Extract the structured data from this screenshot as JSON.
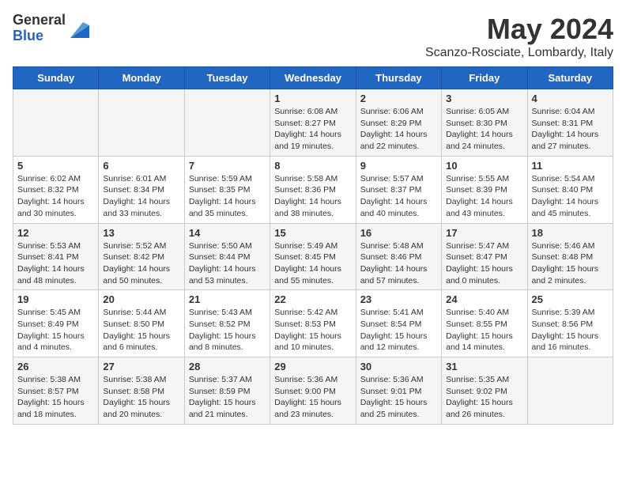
{
  "logo": {
    "general": "General",
    "blue": "Blue"
  },
  "title": "May 2024",
  "location": "Scanzo-Rosciate, Lombardy, Italy",
  "days_of_week": [
    "Sunday",
    "Monday",
    "Tuesday",
    "Wednesday",
    "Thursday",
    "Friday",
    "Saturday"
  ],
  "weeks": [
    [
      {
        "day": "",
        "info": ""
      },
      {
        "day": "",
        "info": ""
      },
      {
        "day": "",
        "info": ""
      },
      {
        "day": "1",
        "info": "Sunrise: 6:08 AM\nSunset: 8:27 PM\nDaylight: 14 hours\nand 19 minutes."
      },
      {
        "day": "2",
        "info": "Sunrise: 6:06 AM\nSunset: 8:29 PM\nDaylight: 14 hours\nand 22 minutes."
      },
      {
        "day": "3",
        "info": "Sunrise: 6:05 AM\nSunset: 8:30 PM\nDaylight: 14 hours\nand 24 minutes."
      },
      {
        "day": "4",
        "info": "Sunrise: 6:04 AM\nSunset: 8:31 PM\nDaylight: 14 hours\nand 27 minutes."
      }
    ],
    [
      {
        "day": "5",
        "info": "Sunrise: 6:02 AM\nSunset: 8:32 PM\nDaylight: 14 hours\nand 30 minutes."
      },
      {
        "day": "6",
        "info": "Sunrise: 6:01 AM\nSunset: 8:34 PM\nDaylight: 14 hours\nand 33 minutes."
      },
      {
        "day": "7",
        "info": "Sunrise: 5:59 AM\nSunset: 8:35 PM\nDaylight: 14 hours\nand 35 minutes."
      },
      {
        "day": "8",
        "info": "Sunrise: 5:58 AM\nSunset: 8:36 PM\nDaylight: 14 hours\nand 38 minutes."
      },
      {
        "day": "9",
        "info": "Sunrise: 5:57 AM\nSunset: 8:37 PM\nDaylight: 14 hours\nand 40 minutes."
      },
      {
        "day": "10",
        "info": "Sunrise: 5:55 AM\nSunset: 8:39 PM\nDaylight: 14 hours\nand 43 minutes."
      },
      {
        "day": "11",
        "info": "Sunrise: 5:54 AM\nSunset: 8:40 PM\nDaylight: 14 hours\nand 45 minutes."
      }
    ],
    [
      {
        "day": "12",
        "info": "Sunrise: 5:53 AM\nSunset: 8:41 PM\nDaylight: 14 hours\nand 48 minutes."
      },
      {
        "day": "13",
        "info": "Sunrise: 5:52 AM\nSunset: 8:42 PM\nDaylight: 14 hours\nand 50 minutes."
      },
      {
        "day": "14",
        "info": "Sunrise: 5:50 AM\nSunset: 8:44 PM\nDaylight: 14 hours\nand 53 minutes."
      },
      {
        "day": "15",
        "info": "Sunrise: 5:49 AM\nSunset: 8:45 PM\nDaylight: 14 hours\nand 55 minutes."
      },
      {
        "day": "16",
        "info": "Sunrise: 5:48 AM\nSunset: 8:46 PM\nDaylight: 14 hours\nand 57 minutes."
      },
      {
        "day": "17",
        "info": "Sunrise: 5:47 AM\nSunset: 8:47 PM\nDaylight: 15 hours\nand 0 minutes."
      },
      {
        "day": "18",
        "info": "Sunrise: 5:46 AM\nSunset: 8:48 PM\nDaylight: 15 hours\nand 2 minutes."
      }
    ],
    [
      {
        "day": "19",
        "info": "Sunrise: 5:45 AM\nSunset: 8:49 PM\nDaylight: 15 hours\nand 4 minutes."
      },
      {
        "day": "20",
        "info": "Sunrise: 5:44 AM\nSunset: 8:50 PM\nDaylight: 15 hours\nand 6 minutes."
      },
      {
        "day": "21",
        "info": "Sunrise: 5:43 AM\nSunset: 8:52 PM\nDaylight: 15 hours\nand 8 minutes."
      },
      {
        "day": "22",
        "info": "Sunrise: 5:42 AM\nSunset: 8:53 PM\nDaylight: 15 hours\nand 10 minutes."
      },
      {
        "day": "23",
        "info": "Sunrise: 5:41 AM\nSunset: 8:54 PM\nDaylight: 15 hours\nand 12 minutes."
      },
      {
        "day": "24",
        "info": "Sunrise: 5:40 AM\nSunset: 8:55 PM\nDaylight: 15 hours\nand 14 minutes."
      },
      {
        "day": "25",
        "info": "Sunrise: 5:39 AM\nSunset: 8:56 PM\nDaylight: 15 hours\nand 16 minutes."
      }
    ],
    [
      {
        "day": "26",
        "info": "Sunrise: 5:38 AM\nSunset: 8:57 PM\nDaylight: 15 hours\nand 18 minutes."
      },
      {
        "day": "27",
        "info": "Sunrise: 5:38 AM\nSunset: 8:58 PM\nDaylight: 15 hours\nand 20 minutes."
      },
      {
        "day": "28",
        "info": "Sunrise: 5:37 AM\nSunset: 8:59 PM\nDaylight: 15 hours\nand 21 minutes."
      },
      {
        "day": "29",
        "info": "Sunrise: 5:36 AM\nSunset: 9:00 PM\nDaylight: 15 hours\nand 23 minutes."
      },
      {
        "day": "30",
        "info": "Sunrise: 5:36 AM\nSunset: 9:01 PM\nDaylight: 15 hours\nand 25 minutes."
      },
      {
        "day": "31",
        "info": "Sunrise: 5:35 AM\nSunset: 9:02 PM\nDaylight: 15 hours\nand 26 minutes."
      },
      {
        "day": "",
        "info": ""
      }
    ]
  ]
}
